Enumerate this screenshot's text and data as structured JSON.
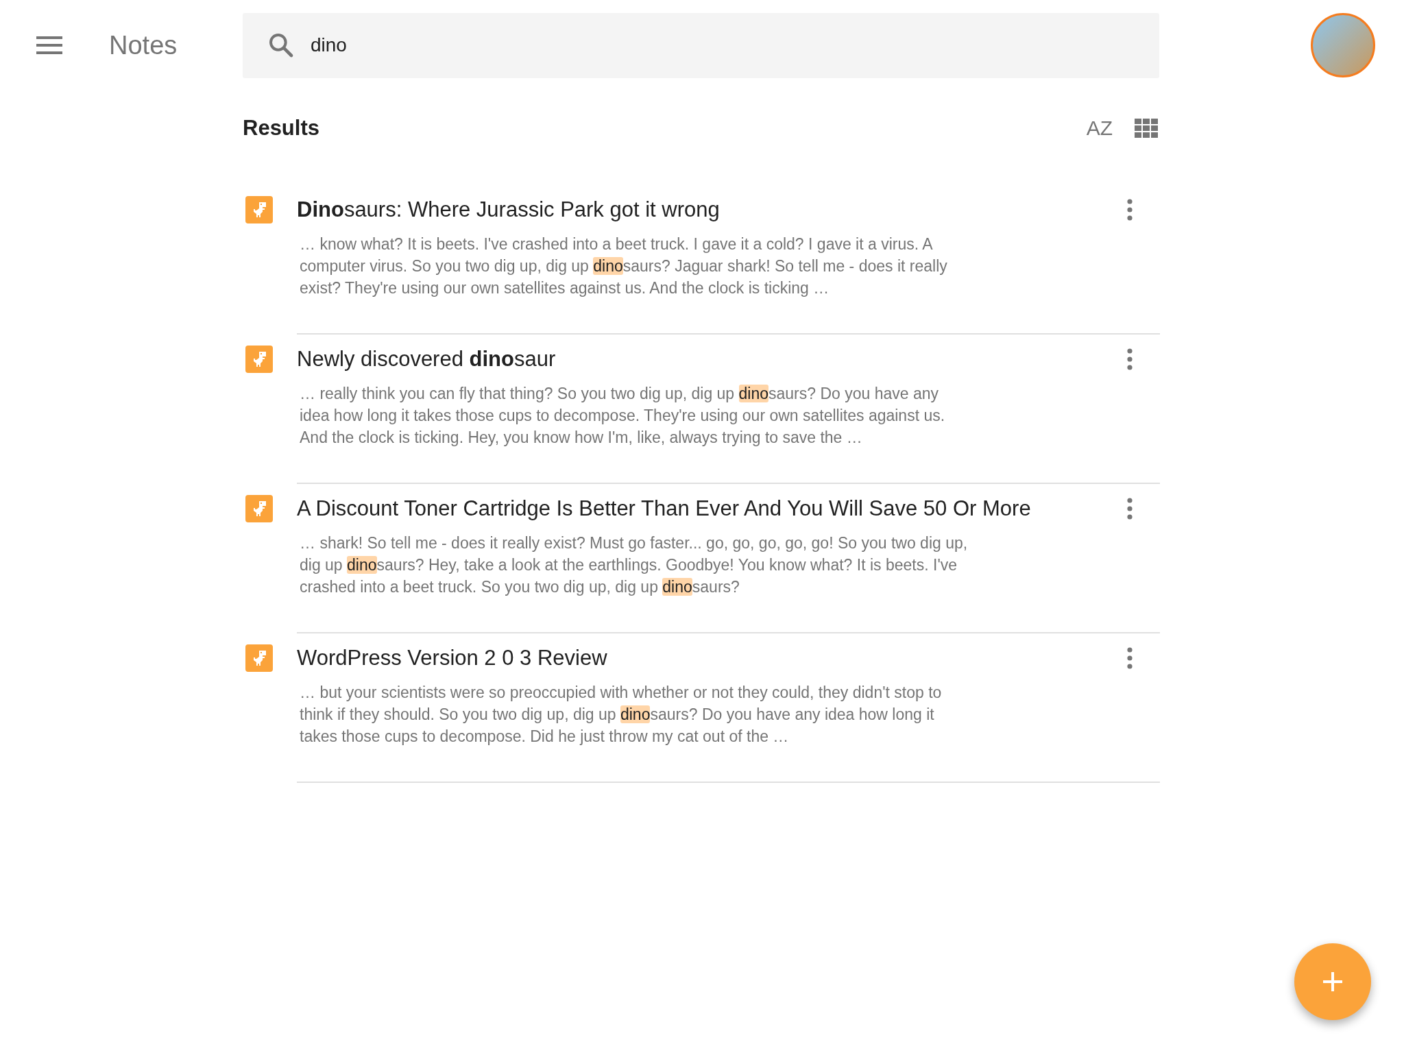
{
  "app_bar": {
    "title": "Notes",
    "search": {
      "value": "dino"
    }
  },
  "results": {
    "heading": "Results",
    "sort_label": "AZ",
    "items": [
      {
        "title": "**Dino**saurs: Where Jurassic Park got it wrong",
        "snippet": [
          {
            "text": "… know what? It is beets. I've crashed into a beet truck. I gave it a cold? I gave it a virus. A computer virus. So you two dig up, dig up ",
            "highlight": false
          },
          {
            "text": "dino",
            "highlight": true
          },
          {
            "text": "saurs? Jaguar shark! So tell me - does it really exist? They're using our own satellites against us. And the clock is ticking …",
            "highlight": false
          }
        ]
      },
      {
        "title": "Newly discovered **dino**saur",
        "snippet": [
          {
            "text": "… really think you can fly that thing? So you two dig up, dig up ",
            "highlight": false
          },
          {
            "text": "dino",
            "highlight": true
          },
          {
            "text": "saurs? Do you have any idea how long it takes those cups to decompose. They're using our own satellites against us. And the clock is ticking. Hey, you know how I'm, like, always trying to save the …",
            "highlight": false
          }
        ]
      },
      {
        "title": "A Discount Toner Cartridge Is Better Than Ever And You Will Save 50 Or More",
        "snippet": [
          {
            "text": "… shark! So tell me - does it really exist? Must go faster... go, go, go, go, go! So you two dig up, dig up ",
            "highlight": false
          },
          {
            "text": "dino",
            "highlight": true
          },
          {
            "text": "saurs? Hey, take a look at the earthlings. Goodbye! You know what? It is beets. I've crashed into a beet truck. So you two dig up, dig up ",
            "highlight": false
          },
          {
            "text": "dino",
            "highlight": true
          },
          {
            "text": "saurs?",
            "highlight": false
          }
        ]
      },
      {
        "title": "WordPress Version 2 0 3 Review",
        "snippet": [
          {
            "text": "… but your scientists were so preoccupied with whether or not they could, they didn't stop to think if they should. So you two dig up, dig up ",
            "highlight": false
          },
          {
            "text": "dino",
            "highlight": true
          },
          {
            "text": "saurs? Do you have any idea how long it takes those cups to decompose. Did he just throw my cat out of the …",
            "highlight": false
          }
        ]
      }
    ]
  }
}
